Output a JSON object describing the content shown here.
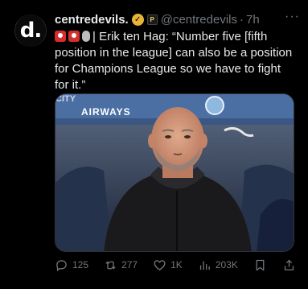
{
  "author": {
    "avatar_text": "d.",
    "display_name": "centredevils.",
    "verified_mark": "✓",
    "affiliation_mark": "P",
    "handle": "@centredevils",
    "separator": "·",
    "time": "7h"
  },
  "more_label": "···",
  "tweet": {
    "text": "| Erik ten Hag: “Number five [fifth position in the league] can also be a position for Champions League so we have to fight for it.”",
    "emojis": [
      "red-circle-icon",
      "red-circle-icon",
      "microphone-icon"
    ]
  },
  "media": {
    "banner_text": "AIRWAYS",
    "banner_text_top": "CITY"
  },
  "actions": {
    "replies": "125",
    "reposts": "277",
    "likes": "1K",
    "views": "203K"
  },
  "colors": {
    "background": "#000000",
    "text": "#e7e9ea",
    "muted": "#71767b",
    "verified": "#e8b339"
  }
}
